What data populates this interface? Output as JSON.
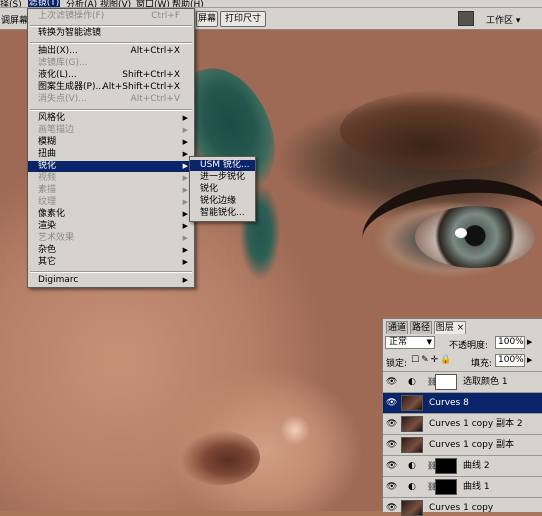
{
  "menubar": {
    "items": [
      {
        "label": "择(S)"
      },
      {
        "label": "滤镜(T)"
      },
      {
        "label": "分析(A)"
      },
      {
        "label": "视图(V)"
      },
      {
        "label": "窗口(W)"
      },
      {
        "label": "帮助(H)"
      }
    ]
  },
  "optbar": {
    "left_label": "调屏幕显",
    "screen_label": "屏幕",
    "print_size_label": "打印尺寸",
    "workspace_label": "工作区 ▾"
  },
  "filter_menu": {
    "items": [
      {
        "label": "上次滤镜操作(F)",
        "shortcut": "Ctrl+F",
        "disabled": true
      },
      {
        "label": "转换为智能滤镜",
        "shortcut": "",
        "disabled": false
      },
      {
        "label": "抽出(X)...",
        "shortcut": "Alt+Ctrl+X",
        "disabled": false
      },
      {
        "label": "滤镜库(G)...",
        "shortcut": "",
        "disabled": true
      },
      {
        "label": "液化(L)...",
        "shortcut": "Shift+Ctrl+X",
        "disabled": false
      },
      {
        "label": "图案生成器(P)...",
        "shortcut": "Alt+Shift+Ctrl+X",
        "disabled": false
      },
      {
        "label": "消失点(V)...",
        "shortcut": "Alt+Ctrl+V",
        "disabled": true
      },
      {
        "label": "风格化",
        "disabled": false
      },
      {
        "label": "画笔描边",
        "disabled": true
      },
      {
        "label": "模糊",
        "disabled": false
      },
      {
        "label": "扭曲",
        "disabled": false
      },
      {
        "label": "锐化",
        "disabled": false,
        "selected": true
      },
      {
        "label": "视频",
        "disabled": true
      },
      {
        "label": "素描",
        "disabled": true
      },
      {
        "label": "纹理",
        "disabled": true
      },
      {
        "label": "像素化",
        "disabled": false
      },
      {
        "label": "渲染",
        "disabled": false
      },
      {
        "label": "艺术效果",
        "disabled": true
      },
      {
        "label": "杂色",
        "disabled": false
      },
      {
        "label": "其它",
        "disabled": false
      },
      {
        "label": "Digimarc",
        "disabled": false
      }
    ]
  },
  "sharpen_submenu": {
    "items": [
      {
        "label": "USM 锐化..."
      },
      {
        "label": "进一步锐化"
      },
      {
        "label": "锐化"
      },
      {
        "label": "锐化边缘"
      },
      {
        "label": "智能锐化..."
      }
    ]
  },
  "layers_panel": {
    "tabs": [
      "通道",
      "路径",
      "图层 ×"
    ],
    "blend_mode": "正常",
    "opacity_label": "不透明度:",
    "opacity_value": "100%",
    "lock_label": "锁定:",
    "fill_label": "填充:",
    "fill_value": "100%",
    "layers": [
      {
        "name": "选取颜色 1",
        "type": "adjustment"
      },
      {
        "name": "Curves 8",
        "type": "image",
        "selected": true
      },
      {
        "name": "Curves 1 copy 副本 2",
        "type": "image"
      },
      {
        "name": "Curves 1 copy 副本",
        "type": "image"
      },
      {
        "name": "曲线 2",
        "type": "adjustment"
      },
      {
        "name": "曲线 1",
        "type": "adjustment"
      },
      {
        "name": "Curves 1 copy",
        "type": "image"
      }
    ]
  },
  "colors": {
    "menu_bg": "#d6d3ce",
    "highlight": "#0a246a",
    "disabled_text": "#8c8a86"
  }
}
